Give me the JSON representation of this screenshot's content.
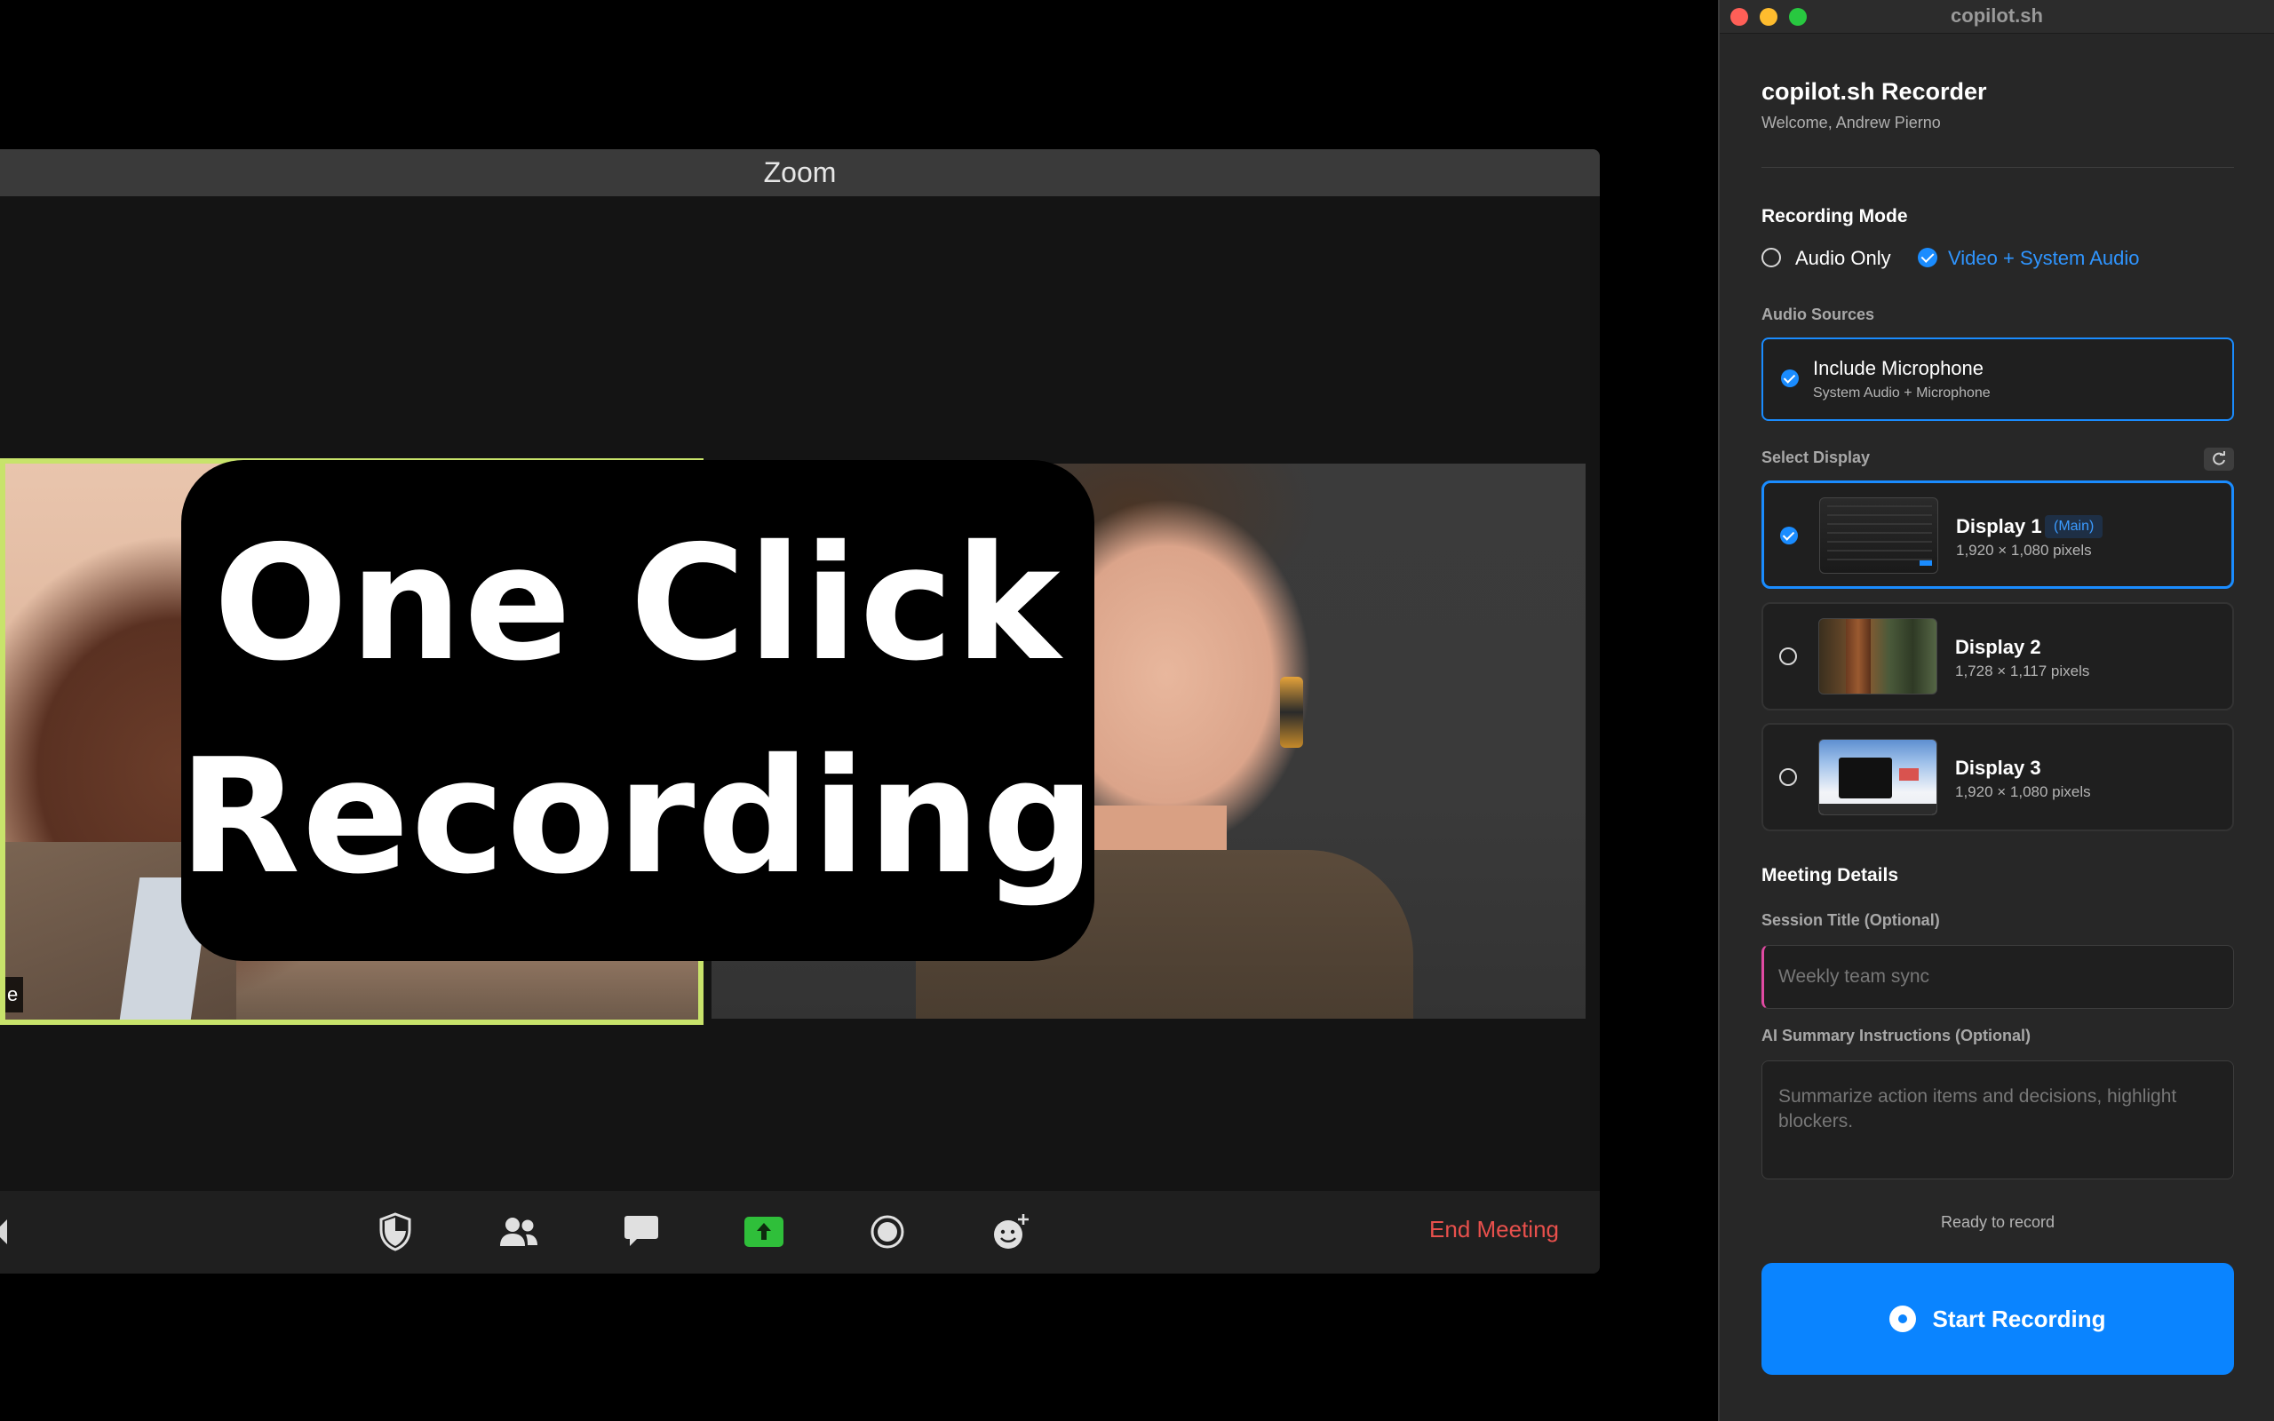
{
  "zoom": {
    "window_title": "Zoom",
    "overlay": {
      "line1": "One Click",
      "line2": "Recording"
    },
    "participant_tag": "e",
    "toolbar": {
      "buttons": [
        "security-icon",
        "participants-icon",
        "chat-icon",
        "share-screen-icon",
        "record-icon",
        "reactions-icon"
      ],
      "end_meeting": "End Meeting"
    },
    "colors": {
      "speaker_border": "#c8e36b",
      "end_meeting": "#e8504c",
      "share_green": "#2fbf3a"
    }
  },
  "recorder": {
    "window_title": "copilot.sh",
    "app_name": "copilot.sh Recorder",
    "welcome": "Welcome, Andrew Pierno",
    "recording_mode": {
      "title": "Recording Mode",
      "options": [
        {
          "label": "Audio Only",
          "selected": false
        },
        {
          "label": "Video + System Audio",
          "selected": true
        }
      ]
    },
    "audio_sources": {
      "label": "Audio Sources",
      "microphone": {
        "title": "Include Microphone",
        "subtitle": "System Audio + Microphone",
        "checked": true
      }
    },
    "select_display": {
      "label": "Select Display",
      "displays": [
        {
          "name": "Display 1",
          "badge": "(Main)",
          "resolution": "1,920 × 1,080 pixels",
          "selected": true
        },
        {
          "name": "Display 2",
          "resolution": "1,728 × 1,117 pixels",
          "selected": false
        },
        {
          "name": "Display 3",
          "resolution": "1,920 × 1,080 pixels",
          "selected": false
        }
      ]
    },
    "meeting_details": {
      "title": "Meeting Details",
      "session_title_label": "Session Title (Optional)",
      "session_title_placeholder": "Weekly team sync",
      "ai_summary_label": "AI Summary Instructions (Optional)",
      "ai_summary_placeholder": "Summarize action items and decisions, highlight blockers."
    },
    "status": "Ready to record",
    "start_button": "Start Recording",
    "colors": {
      "accent": "#0a84ff",
      "traffic_red": "#ff5f57",
      "traffic_yellow": "#febc2e",
      "traffic_green": "#28c840"
    }
  }
}
